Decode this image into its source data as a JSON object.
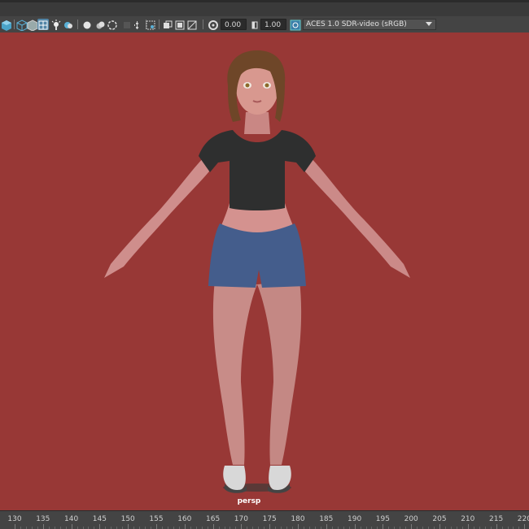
{
  "toolbar": {
    "exposure_value": "0.00",
    "gamma_value": "1.00",
    "colorspace_value": "ACES 1.0 SDR-video (sRGB)",
    "icons": [
      "camera-attributes-icon",
      "wireframe-icon",
      "smooth-shade-icon",
      "selected-shaded-icon",
      "lighting-icon",
      "shadows-icon",
      "ambient-occlusion-icon",
      "motion-blur-icon",
      "anti-alias-icon",
      "depth-of-field-icon",
      "isolate-select-icon",
      "xray-icon",
      "xray-active-icon",
      "xray-joints-icon",
      "backface-icon",
      "exposure-icon",
      "gamma-icon",
      "color-management-icon"
    ]
  },
  "viewport": {
    "camera_label": "persp",
    "background_color": "#983836"
  },
  "timeline": {
    "labels": [
      "130",
      "135",
      "140",
      "145",
      "150",
      "155",
      "160",
      "165",
      "170",
      "175",
      "180",
      "185",
      "190",
      "195",
      "200",
      "205",
      "210",
      "215",
      "220"
    ]
  }
}
